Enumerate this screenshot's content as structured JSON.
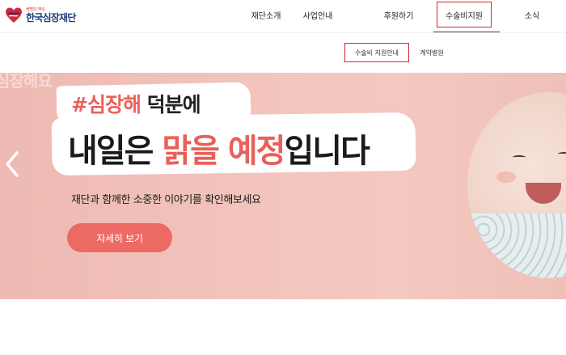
{
  "logo": {
    "tagline": "생명의 약속",
    "name": "한국심장재단",
    "colors": {
      "red": "#d6283a",
      "navy": "#1f3a7a"
    }
  },
  "nav": {
    "items": [
      {
        "label": "재단소개"
      },
      {
        "label": "사업안내"
      },
      {
        "label": "후원하기"
      },
      {
        "label": "수술비지원",
        "active": true
      },
      {
        "label": "소식"
      }
    ]
  },
  "subnav": {
    "items": [
      {
        "label": "수술비 지원안내",
        "active": true
      },
      {
        "label": "계약병원"
      }
    ]
  },
  "hero": {
    "ghost_text": "심장해요",
    "headline1_highlight": "#심장해",
    "headline1_rest": " 덕분에",
    "headline2_start": "내일은 ",
    "headline2_highlight": "맑을 예정",
    "headline2_end": "입니다",
    "subtitle": "재단과 함께한 소중한 이야기를 확인해보세요",
    "button_label": "자세히 보기",
    "prev_icon": "chevron-left-icon",
    "colors": {
      "accent": "#e8615a",
      "button": "#ec6a63",
      "active_border": "#d62828"
    }
  }
}
